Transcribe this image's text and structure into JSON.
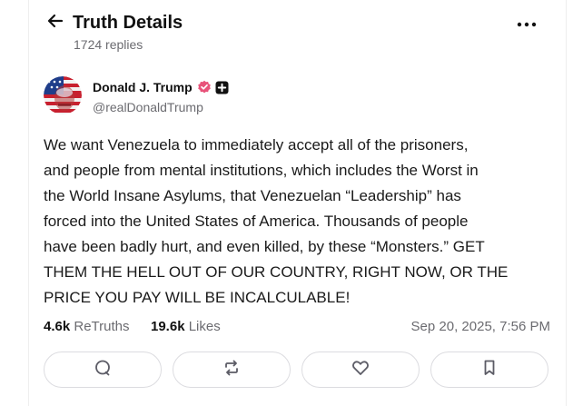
{
  "header": {
    "title": "Truth Details",
    "replies": "1724 replies"
  },
  "author": {
    "name": "Donald J. Trump",
    "handle": "@realDonaldTrump",
    "verified_color": "#e8537a"
  },
  "post": {
    "text": "We want Venezuela to immediately accept all of the prisoners,\nand people from mental institutions, which includes the Worst in\nthe World Insane Asylums, that Venezuelan “Leadership” has\nforced into the United States of America. Thousands of people\nhave been badly hurt, and even killed, by these “Monsters.” GET\nTHEM THE HELL OUT OF OUR COUNTRY, RIGHT NOW, OR THE\nPRICE YOU PAY WILL BE INCALCULABLE!"
  },
  "stats": {
    "retruths_count": "4.6k",
    "retruths_label": "ReTruths",
    "likes_count": "19.6k",
    "likes_label": "Likes",
    "timestamp": "Sep 20, 2025, 7:56 PM"
  },
  "actions": [
    {
      "icon": "reply-icon"
    },
    {
      "icon": "retruth-icon"
    },
    {
      "icon": "like-icon"
    },
    {
      "icon": "bookmark-icon"
    }
  ]
}
